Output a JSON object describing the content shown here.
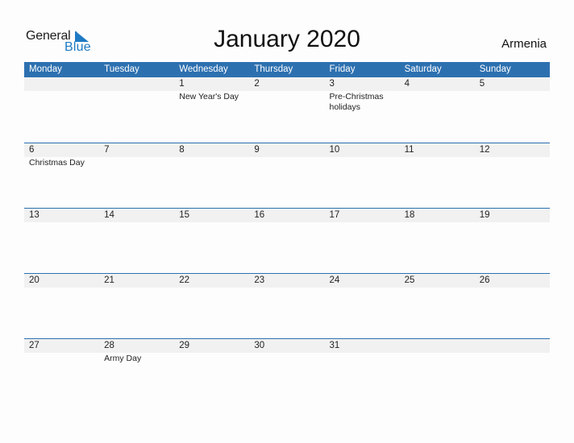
{
  "logo": {
    "line1": "General",
    "line2": "Blue"
  },
  "title": "January 2020",
  "country": "Armenia",
  "colors": {
    "accent": "#2d70b0",
    "strip": "#f1f1f1",
    "logo_blue": "#1f7ac4"
  },
  "weekdays": [
    "Monday",
    "Tuesday",
    "Wednesday",
    "Thursday",
    "Friday",
    "Saturday",
    "Sunday"
  ],
  "weeks": [
    [
      {
        "day": "",
        "event": ""
      },
      {
        "day": "",
        "event": ""
      },
      {
        "day": "1",
        "event": "New Year's Day"
      },
      {
        "day": "2",
        "event": ""
      },
      {
        "day": "3",
        "event": "Pre-Christmas holidays"
      },
      {
        "day": "4",
        "event": ""
      },
      {
        "day": "5",
        "event": ""
      }
    ],
    [
      {
        "day": "6",
        "event": "Christmas Day"
      },
      {
        "day": "7",
        "event": ""
      },
      {
        "day": "8",
        "event": ""
      },
      {
        "day": "9",
        "event": ""
      },
      {
        "day": "10",
        "event": ""
      },
      {
        "day": "11",
        "event": ""
      },
      {
        "day": "12",
        "event": ""
      }
    ],
    [
      {
        "day": "13",
        "event": ""
      },
      {
        "day": "14",
        "event": ""
      },
      {
        "day": "15",
        "event": ""
      },
      {
        "day": "16",
        "event": ""
      },
      {
        "day": "17",
        "event": ""
      },
      {
        "day": "18",
        "event": ""
      },
      {
        "day": "19",
        "event": ""
      }
    ],
    [
      {
        "day": "20",
        "event": ""
      },
      {
        "day": "21",
        "event": ""
      },
      {
        "day": "22",
        "event": ""
      },
      {
        "day": "23",
        "event": ""
      },
      {
        "day": "24",
        "event": ""
      },
      {
        "day": "25",
        "event": ""
      },
      {
        "day": "26",
        "event": ""
      }
    ],
    [
      {
        "day": "27",
        "event": ""
      },
      {
        "day": "28",
        "event": "Army Day"
      },
      {
        "day": "29",
        "event": ""
      },
      {
        "day": "30",
        "event": ""
      },
      {
        "day": "31",
        "event": ""
      },
      {
        "day": "",
        "event": ""
      },
      {
        "day": "",
        "event": ""
      }
    ]
  ]
}
